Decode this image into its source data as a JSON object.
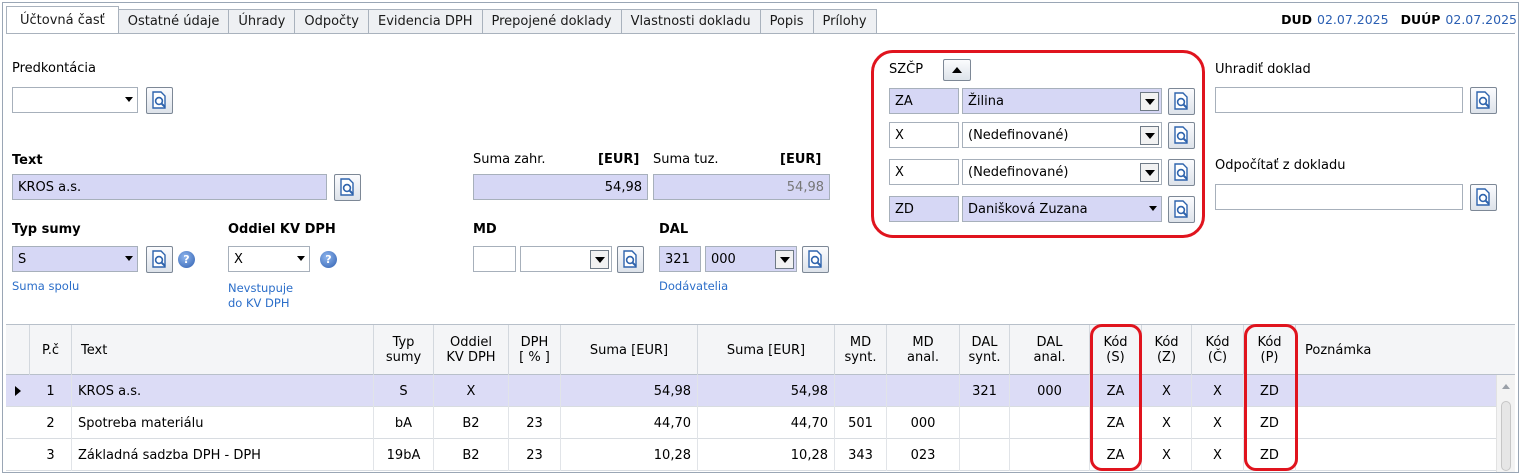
{
  "tabs": [
    "Účtovná časť",
    "Ostatné údaje",
    "Úhrady",
    "Odpočty",
    "Evidencia DPH",
    "Prepojené doklady",
    "Vlastnosti dokladu",
    "Popis",
    "Prílohy"
  ],
  "dates": {
    "dud_label": "DUD",
    "dud_value": "02.07.2025",
    "duup_label": "DUÚP",
    "duup_value": "02.07.2025"
  },
  "predkontacia": {
    "label": "Predkontácia",
    "value": ""
  },
  "text": {
    "label": "Text",
    "value": "KROS a.s."
  },
  "suma_zahr": {
    "label": "Suma zahr.",
    "currency": "[EUR]",
    "value": "54,98"
  },
  "suma_tuz": {
    "label": "Suma tuz.",
    "currency": "[EUR]",
    "value": "54,98"
  },
  "typ_sumy": {
    "label": "Typ sumy",
    "value": "S",
    "hint": "Suma spolu"
  },
  "oddiel_kv": {
    "label": "Oddiel KV DPH",
    "value": "X",
    "hint_line1": "Nevstupuje",
    "hint_line2": "do KV DPH"
  },
  "md": {
    "label": "MD",
    "synt": "",
    "anal": ""
  },
  "dal": {
    "label": "DAL",
    "synt": "321",
    "anal": "000",
    "hint": "Dodávatelia"
  },
  "szcp": {
    "label": "SZČP",
    "rows": [
      {
        "code": "ZA",
        "name": "Žilina"
      },
      {
        "code": "X",
        "name": "(Nedefinované)"
      },
      {
        "code": "X",
        "name": "(Nedefinované)"
      },
      {
        "code": "ZD",
        "name": "Danišková Zuzana"
      }
    ]
  },
  "uhradit": {
    "label": "Uhradiť doklad",
    "value": ""
  },
  "odpocitat": {
    "label": "Odpočítať z dokladu",
    "value": ""
  },
  "grid": {
    "headers": {
      "pc": "P.č",
      "text": "Text",
      "typ": "Typ\nsumy",
      "oddiel": "Oddiel\nKV DPH",
      "dph": "DPH\n[ % ]",
      "suma1": "Suma [EUR]",
      "suma2": "Suma [EUR]",
      "mdsynt": "MD\nsynt.",
      "mdanal": "MD\nanal.",
      "dalsynt": "DAL\nsynt.",
      "dalanal": "DAL\nanal.",
      "kods": "Kód\n(S)",
      "kodz": "Kód\n(Z)",
      "kodc": "Kód\n(Č)",
      "kodp": "Kód\n(P)",
      "pozn": "Poznámka"
    },
    "rows": [
      {
        "pc": "1",
        "text": "KROS a.s.",
        "typ": "S",
        "oddiel": "X",
        "dph": "",
        "suma1": "54,98",
        "suma2": "54,98",
        "mdsynt": "",
        "mdanal": "",
        "dalsynt": "321",
        "dalanal": "000",
        "kods": "ZA",
        "kodz": "X",
        "kodc": "X",
        "kodp": "ZD",
        "pozn": ""
      },
      {
        "pc": "2",
        "text": "Spotreba materiálu",
        "typ": "bA",
        "oddiel": "B2",
        "dph": "23",
        "suma1": "44,70",
        "suma2": "44,70",
        "mdsynt": "501",
        "mdanal": "000",
        "dalsynt": "",
        "dalanal": "",
        "kods": "ZA",
        "kodz": "X",
        "kodc": "X",
        "kodp": "ZD",
        "pozn": ""
      },
      {
        "pc": "3",
        "text": "Základná sadzba DPH - DPH",
        "typ": "19bA",
        "oddiel": "B2",
        "dph": "23",
        "suma1": "10,28",
        "suma2": "10,28",
        "mdsynt": "343",
        "mdanal": "023",
        "dalsynt": "",
        "dalanal": "",
        "kods": "ZA",
        "kodz": "X",
        "kodc": "X",
        "kodp": "ZD",
        "pozn": ""
      }
    ]
  },
  "colors": {
    "highlight_red": "#e0141e",
    "selected_row": "#dcdcf6",
    "field_lavender": "#d6d7f5",
    "hint_blue": "#2b6ec9"
  }
}
